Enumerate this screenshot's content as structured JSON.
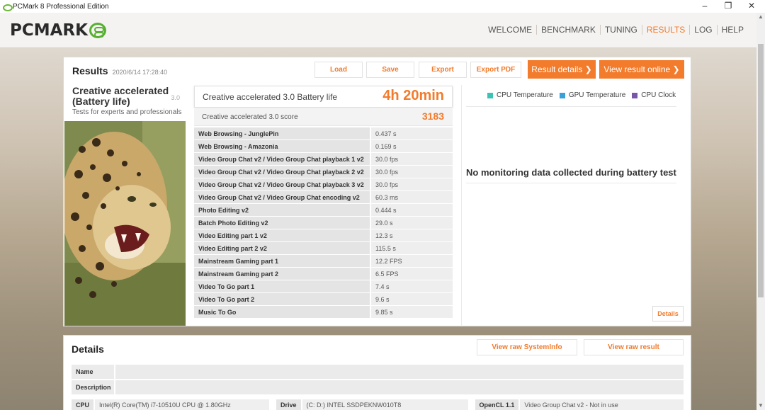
{
  "window": {
    "title": "PCMark 8 Professional Edition",
    "controls": [
      "–",
      "❐",
      "✕"
    ]
  },
  "header": {
    "logo_text": "PCMARK",
    "nav": [
      {
        "label": "WELCOME",
        "active": false
      },
      {
        "label": "BENCHMARK",
        "active": false
      },
      {
        "label": "TUNING",
        "active": false
      },
      {
        "label": "RESULTS",
        "active": true
      },
      {
        "label": "LOG",
        "active": false
      },
      {
        "label": "HELP",
        "active": false
      }
    ]
  },
  "results": {
    "title": "Results",
    "date": "2020/6/14 17:28:40",
    "buttons": {
      "load": "Load",
      "save": "Save",
      "export": "Export",
      "export_pdf": "Export PDF",
      "result_details": "Result details ❯",
      "view_online": "View result online ❯"
    },
    "test": {
      "name": "Creative accelerated (Battery life)",
      "version": "3.0",
      "description": "Tests for experts and professionals"
    },
    "main_score": {
      "label": "Creative accelerated 3.0 Battery life",
      "value": "4h 20min"
    },
    "sub_score": {
      "label": "Creative accelerated 3.0 score",
      "value": "3183"
    },
    "benchmarks": [
      {
        "name": "Web Browsing - JunglePin",
        "value": "0.437 s"
      },
      {
        "name": "Web Browsing - Amazonia",
        "value": "0.169 s"
      },
      {
        "name": "Video Group Chat v2 / Video Group Chat playback 1 v2",
        "value": "30.0 fps"
      },
      {
        "name": "Video Group Chat v2 / Video Group Chat playback 2 v2",
        "value": "30.0 fps"
      },
      {
        "name": "Video Group Chat v2 / Video Group Chat playback 3 v2",
        "value": "30.0 fps"
      },
      {
        "name": "Video Group Chat v2 / Video Group Chat encoding v2",
        "value": "60.3 ms"
      },
      {
        "name": "Photo Editing v2",
        "value": "0.444 s"
      },
      {
        "name": "Batch Photo Editing v2",
        "value": "29.0 s"
      },
      {
        "name": "Video Editing part 1 v2",
        "value": "12.3 s"
      },
      {
        "name": "Video Editing part 2 v2",
        "value": "115.5 s"
      },
      {
        "name": "Mainstream Gaming part 1",
        "value": "12.2 FPS"
      },
      {
        "name": "Mainstream Gaming part 2",
        "value": "6.5 FPS"
      },
      {
        "name": "Video To Go part 1",
        "value": "7.4 s"
      },
      {
        "name": "Video To Go part 2",
        "value": "9.6 s"
      },
      {
        "name": "Music To Go",
        "value": "9.85 s"
      }
    ],
    "monitoring": {
      "legend": [
        {
          "label": "CPU Temperature",
          "color": "#3cc3b4"
        },
        {
          "label": "GPU Temperature",
          "color": "#3aa0d8"
        },
        {
          "label": "CPU Clock",
          "color": "#7a56a8"
        }
      ],
      "message": "No monitoring data collected during battery test",
      "details_button": "Details"
    }
  },
  "details": {
    "title": "Details",
    "buttons": {
      "raw_systeminfo": "View raw SystemInfo",
      "raw_result": "View raw result"
    },
    "name_label": "Name",
    "description_label": "Description",
    "cpu_label": "CPU",
    "cpu_value": "Intel(R) Core(TM) i7-10510U CPU @ 1.80GHz",
    "drive_label": "Drive",
    "drive_value": "(C: D:) INTEL SSDPEKNW010T8",
    "opencl_label": "OpenCL 1.1",
    "opencl_value": "Video Group Chat v2 - Not in use"
  },
  "accent_color": "#f27b2c"
}
